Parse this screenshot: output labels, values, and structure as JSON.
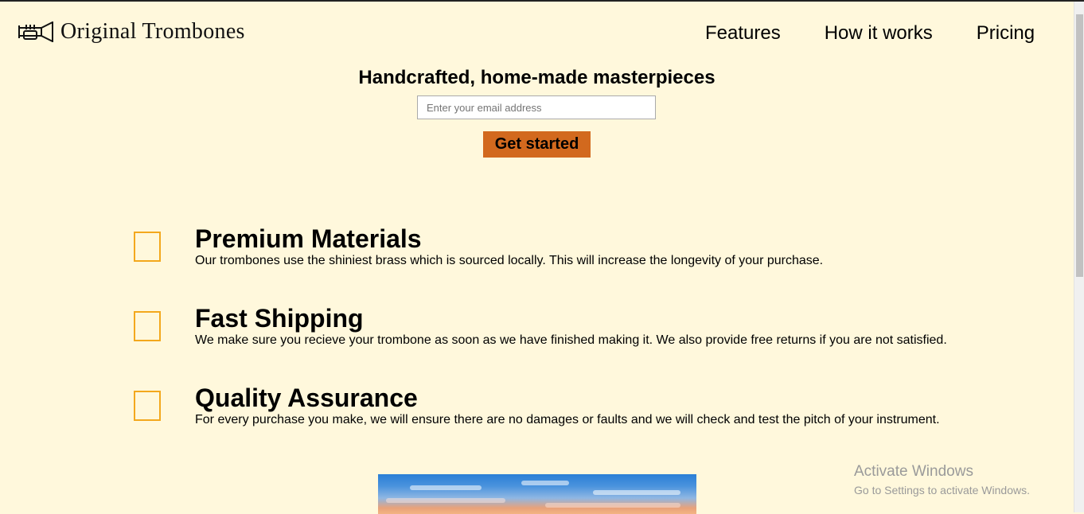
{
  "header": {
    "logo_icon": "trombone-icon",
    "logo_text": "Original Trombones",
    "nav": [
      {
        "label": "Features"
      },
      {
        "label": "How it works"
      },
      {
        "label": "Pricing"
      }
    ]
  },
  "hero": {
    "title": "Handcrafted, home-made masterpieces",
    "email_placeholder": "Enter your email address",
    "cta_label": "Get started"
  },
  "features": [
    {
      "title": "Premium Materials",
      "description": "Our trombones use the shiniest brass which is sourced locally. This will increase the longevity of your purchase."
    },
    {
      "title": "Fast Shipping",
      "description": "We make sure you recieve your trombone as soon as we have finished making it. We also provide free returns if you are not satisfied."
    },
    {
      "title": "Quality Assurance",
      "description": "For every purchase you make, we will ensure there are no damages or faults and we will check and test the pitch of your instrument."
    }
  ],
  "watermark": {
    "line1": "Activate Windows",
    "line2": "Go to Settings to activate Windows."
  },
  "colors": {
    "background": "#fff8dc",
    "accent": "#d2691e",
    "feature_icon_border": "#f3a81d"
  }
}
